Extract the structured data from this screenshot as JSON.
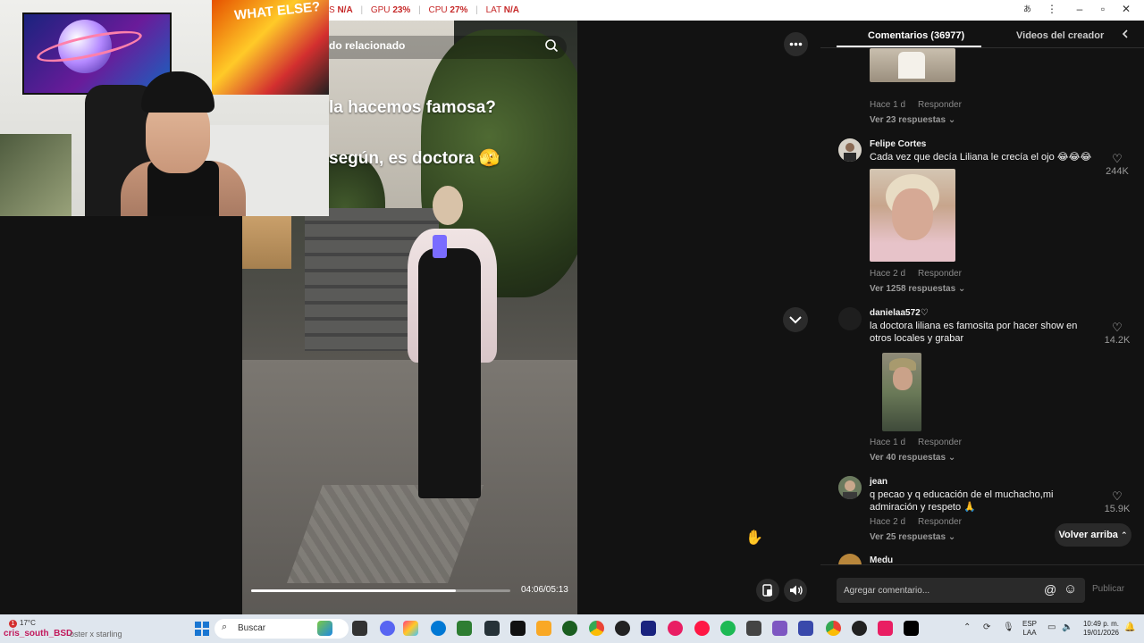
{
  "stats": {
    "first_value": "N/A",
    "gpu_label": "GPU",
    "gpu_value": "23%",
    "cpu_label": "CPU",
    "cpu_value": "27%",
    "lat_label": "LAT",
    "lat_value": "N/A",
    "first_label_fragment": "S"
  },
  "video": {
    "search_text": "do relacionado",
    "caption_line1": "la hacemos famosa?",
    "caption_line2": "según, es doctora 🫣",
    "time": "04:06/05:13",
    "progress": 0.79
  },
  "panel": {
    "tab_comments": "Comentarios (36977)",
    "tab_creator": "Videos del creador",
    "scroll_top_label": "Volver arriba",
    "composer_placeholder": "Agregar comentario...",
    "publish_label": "Publicar"
  },
  "comments": [
    {
      "meta_time": "Hace 1 d",
      "reply_label": "Responder",
      "replies": "Ver 23 respuestas"
    },
    {
      "user": "Felipe Cortes",
      "text": "Cada vez que decía Liliana le crecía el ojo 😂😂😂",
      "likes": "244K",
      "meta_time": "Hace 2 d",
      "reply_label": "Responder",
      "replies": "Ver 1258 respuestas"
    },
    {
      "user": "danielaa572♡",
      "text": "la doctora liliana es famosita por hacer show en otros locales y grabar",
      "likes": "14.2K",
      "meta_time": "Hace 1 d",
      "reply_label": "Responder",
      "replies": "Ver 40 respuestas"
    },
    {
      "user": "jean",
      "text": "q pecao y q educación de el muchacho,mi admiración y respeto 🙏",
      "likes": "15.9K",
      "meta_time": "Hace 2 d",
      "reply_label": "Responder",
      "replies": "Ver 25 respuestas"
    },
    {
      "user": "Medu"
    }
  ],
  "overlay": {
    "channel": "cris_south_BSD",
    "status_text": "oster x starling",
    "notif_count": "1"
  },
  "taskbar": {
    "weather": "17°C",
    "search_label": "Buscar",
    "lang_line1": "ESP",
    "lang_line2": "LAA",
    "time": "10:49 p. m.",
    "date": "19/01/2026"
  },
  "icons": {
    "more": "more-horizontal-icon",
    "down": "chevron-down-icon",
    "heart": "heart-outline-icon",
    "volume": "speaker-icon"
  }
}
